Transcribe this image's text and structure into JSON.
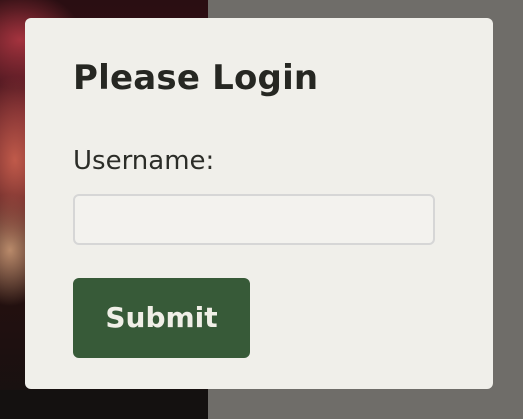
{
  "login": {
    "title": "Please Login",
    "username_label": "Username:",
    "username_value": "",
    "submit_label": "Submit"
  },
  "colors": {
    "card_background": "#f0efea",
    "submit_background": "#375a38",
    "submit_text": "#f0efe7",
    "overlay_background": "#6f6d69"
  }
}
